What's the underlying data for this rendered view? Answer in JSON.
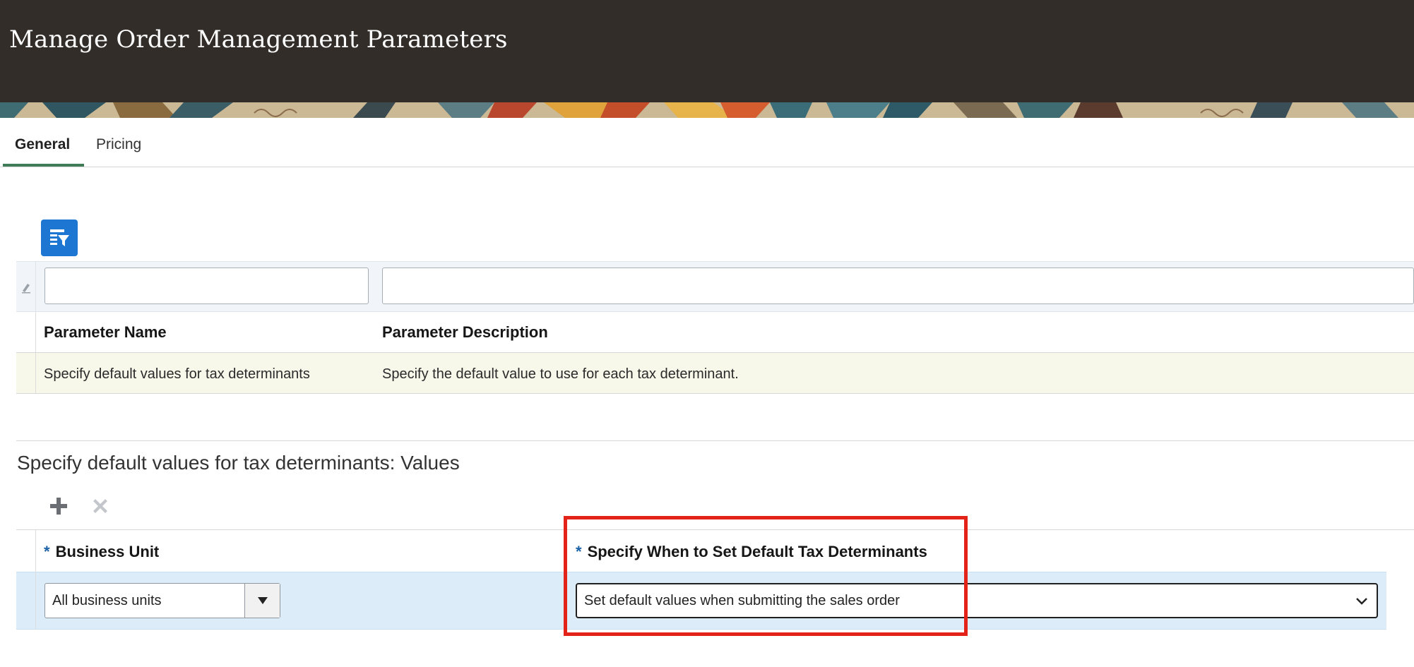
{
  "header": {
    "title": "Manage Order Management Parameters"
  },
  "tabs": [
    {
      "label": "General",
      "active": true
    },
    {
      "label": "Pricing",
      "active": false
    }
  ],
  "search": {
    "icon": "query-by-example-icon",
    "parameter_name_value": "",
    "parameter_description_value": ""
  },
  "parameters_table": {
    "columns": [
      "Parameter Name",
      "Parameter Description"
    ],
    "rows": [
      {
        "name": "Specify default values for tax determinants",
        "description": "Specify the default value to use for each tax determinant."
      }
    ]
  },
  "values_section": {
    "title": "Specify default values for tax determinants: Values",
    "toolbar": {
      "add_icon": "plus-icon",
      "delete_icon": "close-icon"
    },
    "required_marker": "*",
    "columns": [
      "Business Unit",
      "Specify When to Set Default Tax Determinants"
    ],
    "rows": [
      {
        "business_unit": "All business units",
        "when_to_set": "Set default values when submitting the sales order"
      }
    ]
  },
  "colors": {
    "header_bg": "#322d29",
    "accent_blue": "#1c76d2",
    "selected_row": "#dcecf9",
    "highlight_row": "#f7f8ea",
    "callout_red": "#e32218"
  }
}
